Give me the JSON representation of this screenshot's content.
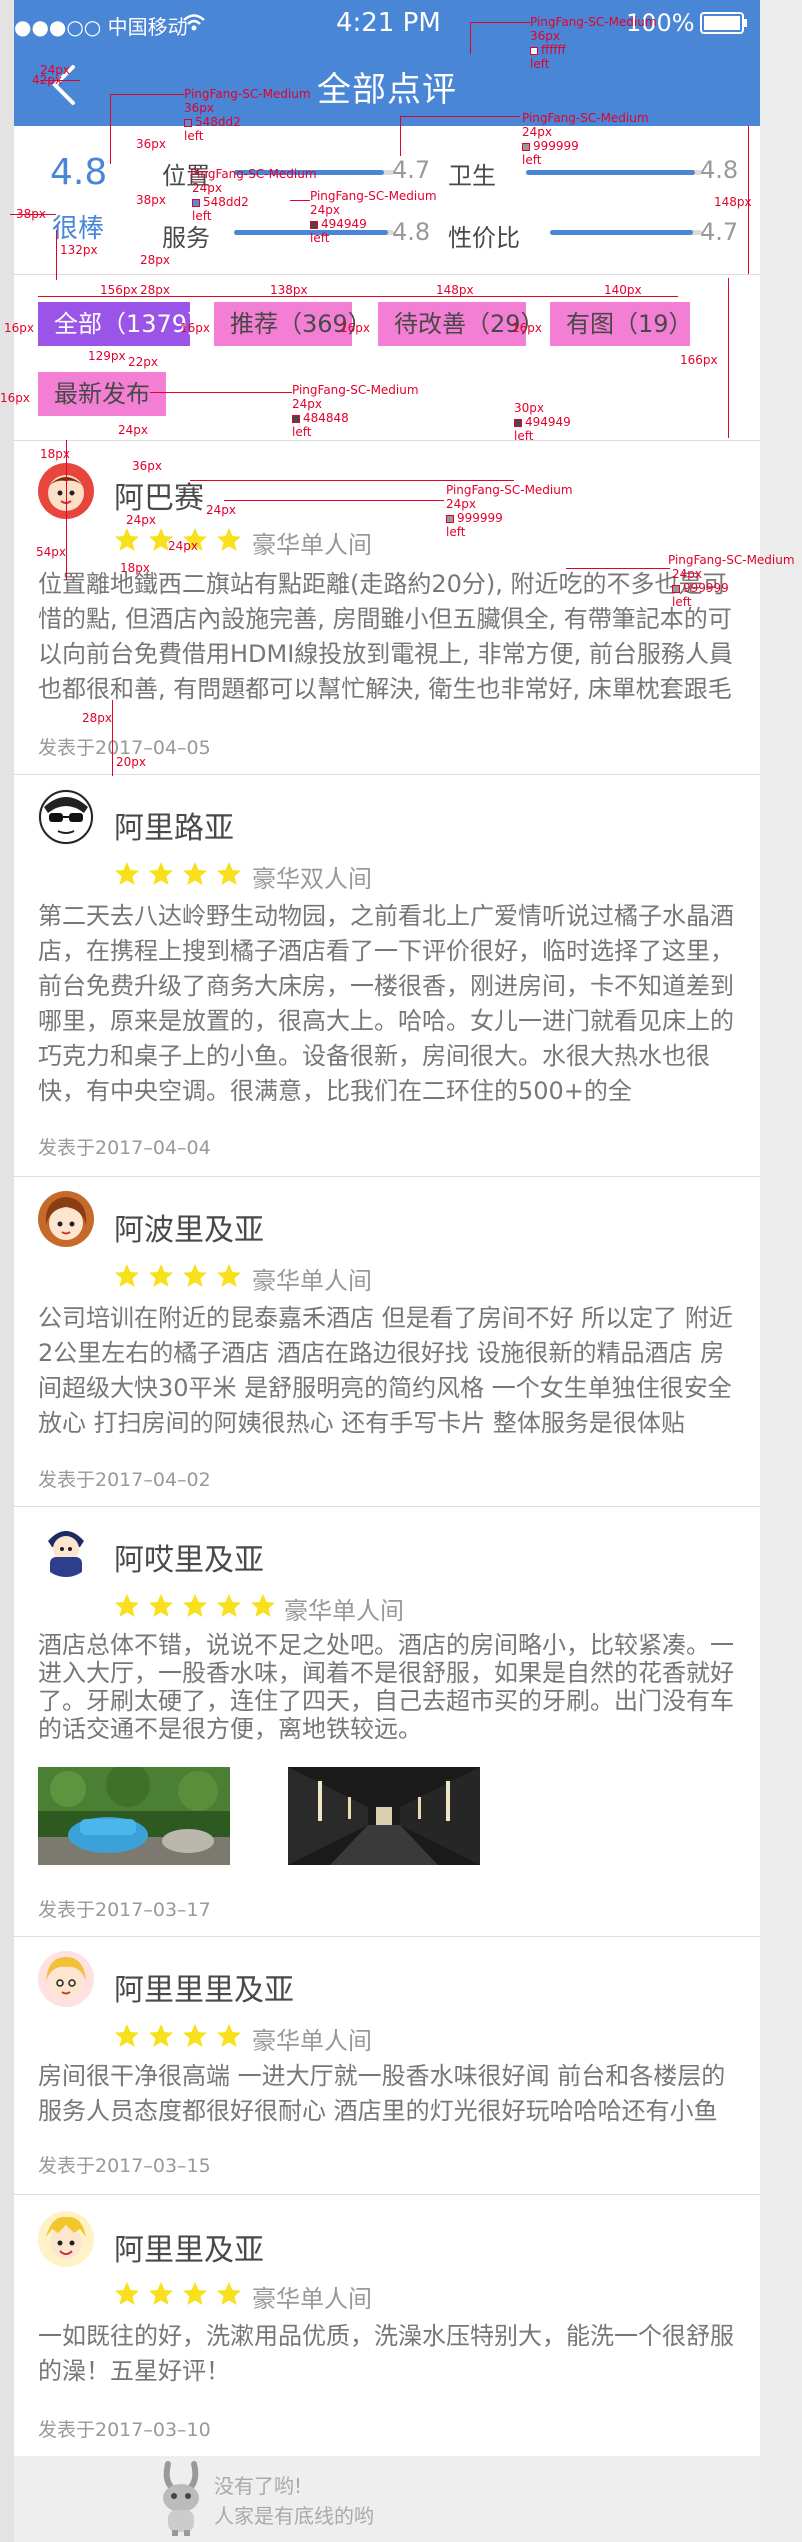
{
  "status": {
    "carrier": "●●●○○ 中国移动",
    "time": "4:21 PM",
    "battery": "100%"
  },
  "nav": {
    "title": "全部点评"
  },
  "summary": {
    "score": "4.8",
    "rating_word": "很棒",
    "categories": [
      {
        "name": "位置",
        "value": "4.7",
        "ratio": 0.94
      },
      {
        "name": "卫生",
        "value": "4.8",
        "ratio": 0.96
      },
      {
        "name": "服务",
        "value": "4.8",
        "ratio": 0.96
      },
      {
        "name": "性价比",
        "value": "4.7",
        "ratio": 0.94
      }
    ]
  },
  "filters": [
    "全部（1379）",
    "推荐（369）",
    "待改善（29）",
    "有图（19）",
    "最新发布"
  ],
  "reviews": [
    {
      "name": "阿巴赛",
      "stars": 4,
      "room": "豪华单人间",
      "text": "位置離地鐵西二旗站有點距離(走路約20分), 附近吃的不多也是可惜的點, 但酒店內設施完善, 房間雖小但五臟俱全, 有帶筆記本的可以向前台免費借用HDMI線投放到電視上, 非常方便, 前台服務人員也都很和善, 有問題都可以幫忙解決, 衛生也非常好, 床單枕套跟毛",
      "date": "发表于2017–04–05"
    },
    {
      "name": "阿里路亚",
      "stars": 4,
      "room": "豪华双人间",
      "text": "第二天去八达岭野生动物园，之前看北上广爱情听说过橘子水晶酒店，在携程上搜到橘子酒店看了一下评价很好，临时选择了这里，前台免费升级了商务大床房，一楼很香，刚进房间，卡不知道差到哪里，原来是放置的，很高大上。哈哈。女儿一进门就看见床上的巧克力和桌子上的小鱼。设备很新，房间很大。水很大热水也很快，有中央空调。很满意，比我们在二环住的500+的全",
      "date": "发表于2017–04–04"
    },
    {
      "name": "阿波里及亚",
      "stars": 4,
      "room": "豪华单人间",
      "text": "公司培训在附近的昆泰嘉禾酒店 但是看了房间不好 所以定了 附近2公里左右的橘子酒店 酒店在路边很好找 设施很新的精品酒店 房间超级大快30平米 是舒服明亮的简约风格 一个女生单独住很安全放心 打扫房间的阿姨很热心 还有手写卡片 整体服务是很体贴",
      "date": "发表于2017–04–02"
    },
    {
      "name": "阿哎里及亚",
      "stars": 5,
      "room": "豪华单人间",
      "text": "酒店总体不错，说说不足之处吧。酒店的房间略小，比较紧凑。一进入大厅，一股香水味，闻着不是很舒服，如果是自然的花香就好了。牙刷太硬了，连住了四天，自己去超市买的牙刷。出门没有车的话交通不是很方便，离地铁较远。",
      "date": "发表于2017–03–17"
    },
    {
      "name": "阿里里里及亚",
      "stars": 4,
      "room": "豪华单人间",
      "text": "房间很干净很高端 一进大厅就一股香水味很好闻 前台和各楼层的服务人员态度都很好很耐心 酒店里的灯光很好玩哈哈哈还有小鱼",
      "date": "发表于2017–03–15"
    },
    {
      "name": "阿里里及亚",
      "stars": 4,
      "room": "豪华单人间",
      "text": "一如既往的好，洗漱用品优质，洗澡水压特别大，能洗一个很舒服的澡！五星好评！",
      "date": "发表于2017–03–10"
    }
  ],
  "footer": {
    "line1": "没有了哟!",
    "line2": "人家是有底线的哟"
  },
  "annotations": {
    "font": "PingFang-SC-Medium",
    "px": [
      "42px",
      "36px",
      "38px",
      "24px",
      "132px",
      "28px",
      "148px",
      "156px",
      "138px",
      "140px",
      "16px",
      "129px",
      "22px",
      "166px",
      "54px",
      "18px",
      "20px",
      "30px"
    ],
    "colors": [
      "ffffff",
      "548dd2",
      "999999",
      "494949",
      "484848"
    ],
    "left": "left"
  }
}
